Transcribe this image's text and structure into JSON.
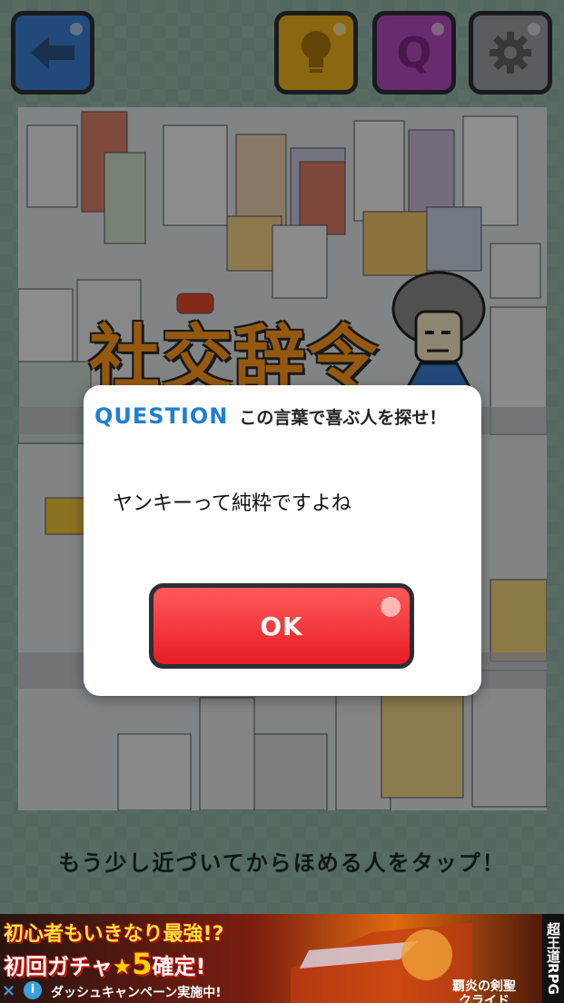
{
  "toolbar": {
    "back_icon": "arrow-left-icon",
    "hint_icon": "lightbulb-icon",
    "question_icon": "Q",
    "settings_icon": "gear-icon",
    "colors": {
      "back": "#3a7fd0",
      "hint": "#f0b21a",
      "question": "#b54ac0",
      "settings": "#9aa0a6"
    }
  },
  "scene": {
    "title": "社交辞令"
  },
  "instruction": "もう少し近づいてからほめる人をタップ！",
  "modal": {
    "label": "QUESTION",
    "prompt": "この言葉で喜ぶ人を探せ！",
    "phrase": "ヤンキーって純粋ですよね",
    "ok_label": "OK"
  },
  "ad": {
    "line1": "初心者もいきなり最強!?",
    "line2_prefix": "初回ガチャ",
    "line2_star": "★",
    "line2_number": "5",
    "line2_suffix": "確定!",
    "line3": "ダッシュキャンペーン実施中!",
    "subtitle1": "覇炎の剣聖",
    "subtitle2": "クライド",
    "side_label": "超王道RPG",
    "close_icon": "×",
    "info_icon": "i"
  }
}
